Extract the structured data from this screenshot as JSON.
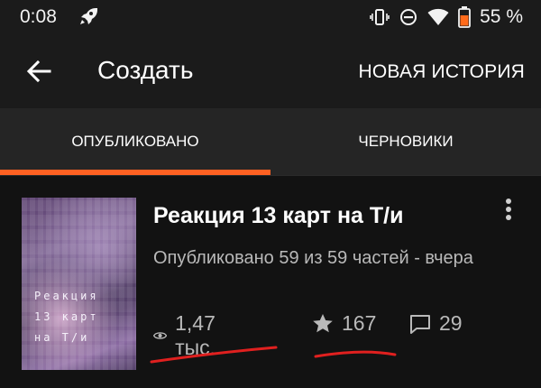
{
  "status": {
    "time": "0:08",
    "battery_percent": "55 %",
    "icons": [
      "rocket-icon",
      "vibrate-icon",
      "do-not-disturb-icon",
      "wifi-icon",
      "battery-icon"
    ]
  },
  "app_bar": {
    "title": "Создать",
    "action_label": "НОВАЯ ИСТОРИЯ"
  },
  "tabs": [
    {
      "label": "ОПУБЛИКОВАНО",
      "active": true
    },
    {
      "label": "ЧЕРНОВИКИ",
      "active": false
    }
  ],
  "story": {
    "cover_text": "Реакция\n13 карт\nна Т/и",
    "title": "Реакция 13 карт на Т/и",
    "meta": "Опубликовано 59 из 59 частей - вчера",
    "views": "1,47 тыс.",
    "votes": "167",
    "comments": "29"
  },
  "colors": {
    "accent": "#ff6122",
    "annotation": "#e0201f",
    "background": "#121212",
    "toolbar": "#1b1b1b",
    "tabs": "#252525"
  }
}
